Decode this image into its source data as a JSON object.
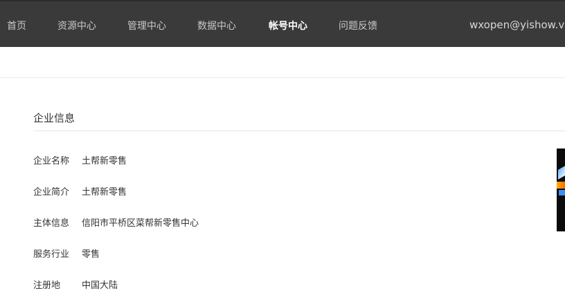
{
  "nav": {
    "items": [
      {
        "label": "首页"
      },
      {
        "label": "资源中心"
      },
      {
        "label": "管理中心"
      },
      {
        "label": "数据中心"
      },
      {
        "label": "帐号中心",
        "active": true
      },
      {
        "label": "问题反馈"
      }
    ],
    "account": "wxopen@yishow.vip"
  },
  "section": {
    "title": "企业信息"
  },
  "info": [
    {
      "label": "企业名称",
      "value": "土帮新零售"
    },
    {
      "label": "企业简介",
      "value": "土帮新零售"
    },
    {
      "label": "主体信息",
      "value": "信阳市平桥区菜帮新零售中心"
    },
    {
      "label": "服务行业",
      "value": "零售"
    },
    {
      "label": "注册地",
      "value": "中国大陆"
    }
  ],
  "colors": {
    "topbar": "#3a3a3a",
    "nav_text": "#c9c9c9",
    "nav_active": "#ffffff",
    "body_text": "#333333"
  }
}
